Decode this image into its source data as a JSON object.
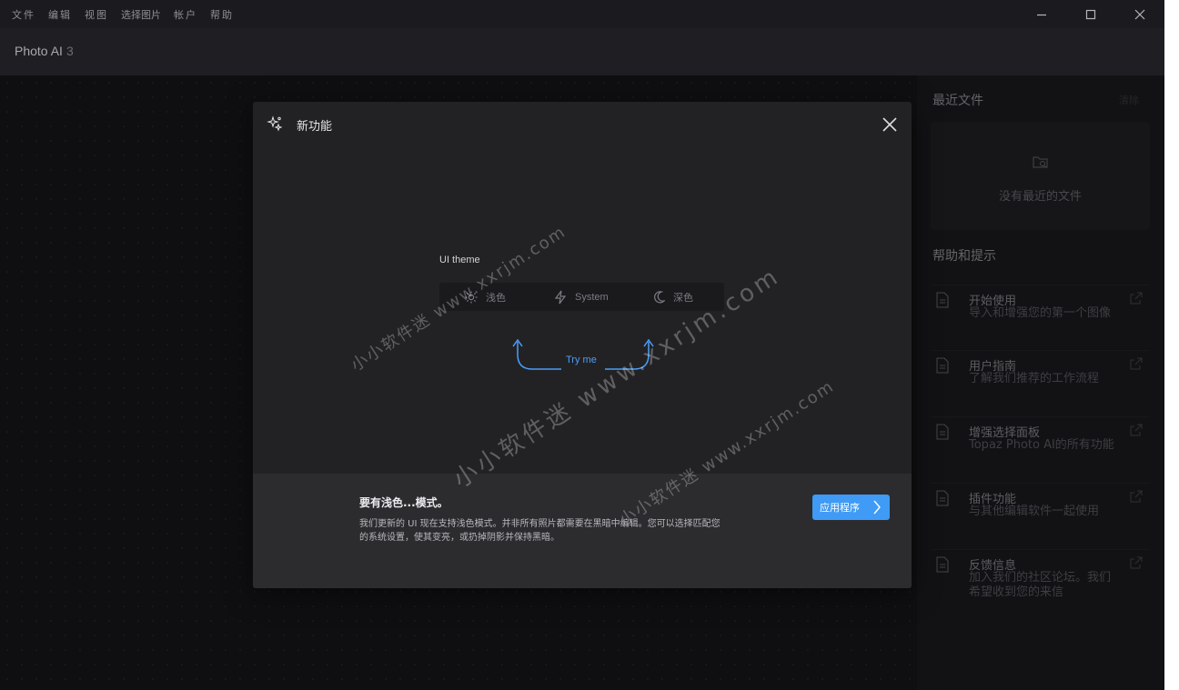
{
  "menu": [
    "文件",
    "编辑",
    "视图",
    "选择图片",
    "帐户",
    "帮助"
  ],
  "app": {
    "name": "Photo AI",
    "version": "3"
  },
  "sidebar": {
    "recent_title": "最近文件",
    "clear_label": "清除",
    "no_recent": "没有最近的文件",
    "help_title": "帮助和提示",
    "help_items": [
      {
        "title": "开始使用",
        "desc": "导入和增强您的第一个图像"
      },
      {
        "title": "用户指南",
        "desc": "了解我们推荐的工作流程"
      },
      {
        "title": "增强选择面板",
        "desc": "Topaz Photo AI的所有功能"
      },
      {
        "title": "插件功能",
        "desc": "与其他编辑软件一起使用"
      },
      {
        "title": "反馈信息",
        "desc": "加入我们的社区论坛。我们希望收到您的来信"
      }
    ]
  },
  "modal": {
    "title": "新功能",
    "theme_label": "UI theme",
    "options": [
      "浅色",
      "System",
      "深色"
    ],
    "try_label": "Try me",
    "heading": "要有浅色...模式。",
    "description": "我们更新的 UI 现在支持浅色模式。并非所有照片都需要在黑暗中编辑。您可以选择匹配您的系统设置，使其变亮，或扔掉阴影并保持黑暗。",
    "apply_label": "应用程序"
  },
  "watermark": [
    "小小软件迷 www.xxrjm.com",
    "小小软件迷 www.xxrjm.com",
    "小小软件迷 www.xxrjm.com"
  ],
  "colors": {
    "accent": "#3f9bf5",
    "background": "#17171b",
    "modal": "#222225"
  }
}
